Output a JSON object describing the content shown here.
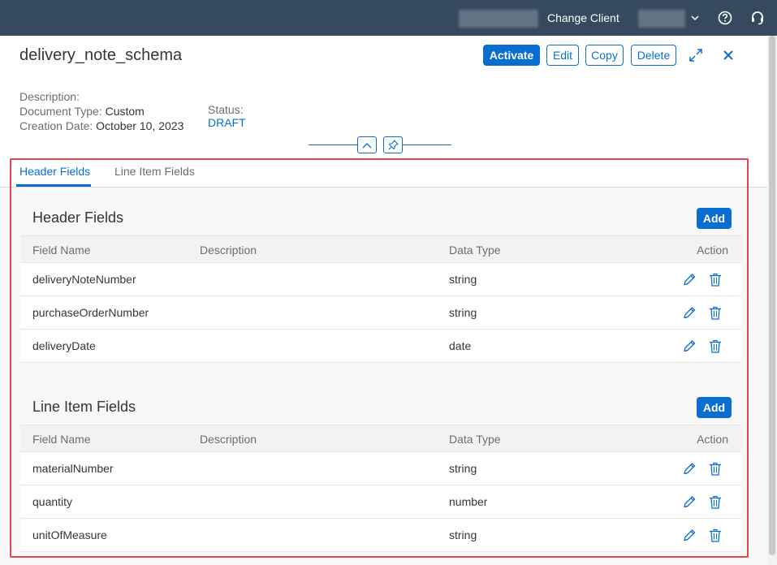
{
  "shell": {
    "change_client_label": "Change Client"
  },
  "object": {
    "title": "delivery_note_schema",
    "actions": {
      "activate": "Activate",
      "edit": "Edit",
      "copy": "Copy",
      "delete": "Delete"
    },
    "attributes": {
      "description_label": "Description:",
      "description_value": "",
      "document_type_label": "Document Type:",
      "document_type_value": "Custom",
      "creation_date_label": "Creation Date:",
      "creation_date_value": "October 10, 2023",
      "status_label": "Status:",
      "status_value": "DRAFT"
    }
  },
  "tabs": [
    {
      "label": "Header Fields",
      "selected": true
    },
    {
      "label": "Line Item Fields",
      "selected": false
    }
  ],
  "sections": {
    "header_fields": {
      "title": "Header Fields",
      "add_label": "Add",
      "columns": [
        "Field Name",
        "Description",
        "Data Type",
        "Action"
      ],
      "rows": [
        {
          "field_name": "deliveryNoteNumber",
          "description": "",
          "data_type": "string"
        },
        {
          "field_name": "purchaseOrderNumber",
          "description": "",
          "data_type": "string"
        },
        {
          "field_name": "deliveryDate",
          "description": "",
          "data_type": "date"
        }
      ]
    },
    "line_item_fields": {
      "title": "Line Item Fields",
      "add_label": "Add",
      "columns": [
        "Field Name",
        "Description",
        "Data Type",
        "Action"
      ],
      "rows": [
        {
          "field_name": "materialNumber",
          "description": "",
          "data_type": "string"
        },
        {
          "field_name": "quantity",
          "description": "",
          "data_type": "number"
        },
        {
          "field_name": "unitOfMeasure",
          "description": "",
          "data_type": "string"
        }
      ]
    }
  },
  "colors": {
    "shell_bg": "#354a5f",
    "brand_blue": "#0a6ed1",
    "highlight_red": "#e0484b"
  },
  "icons": [
    "chevron-down-icon",
    "help-icon",
    "headset-icon",
    "expand-icon",
    "close-icon",
    "collapse-header-icon",
    "pin-icon",
    "edit-icon",
    "delete-icon"
  ]
}
